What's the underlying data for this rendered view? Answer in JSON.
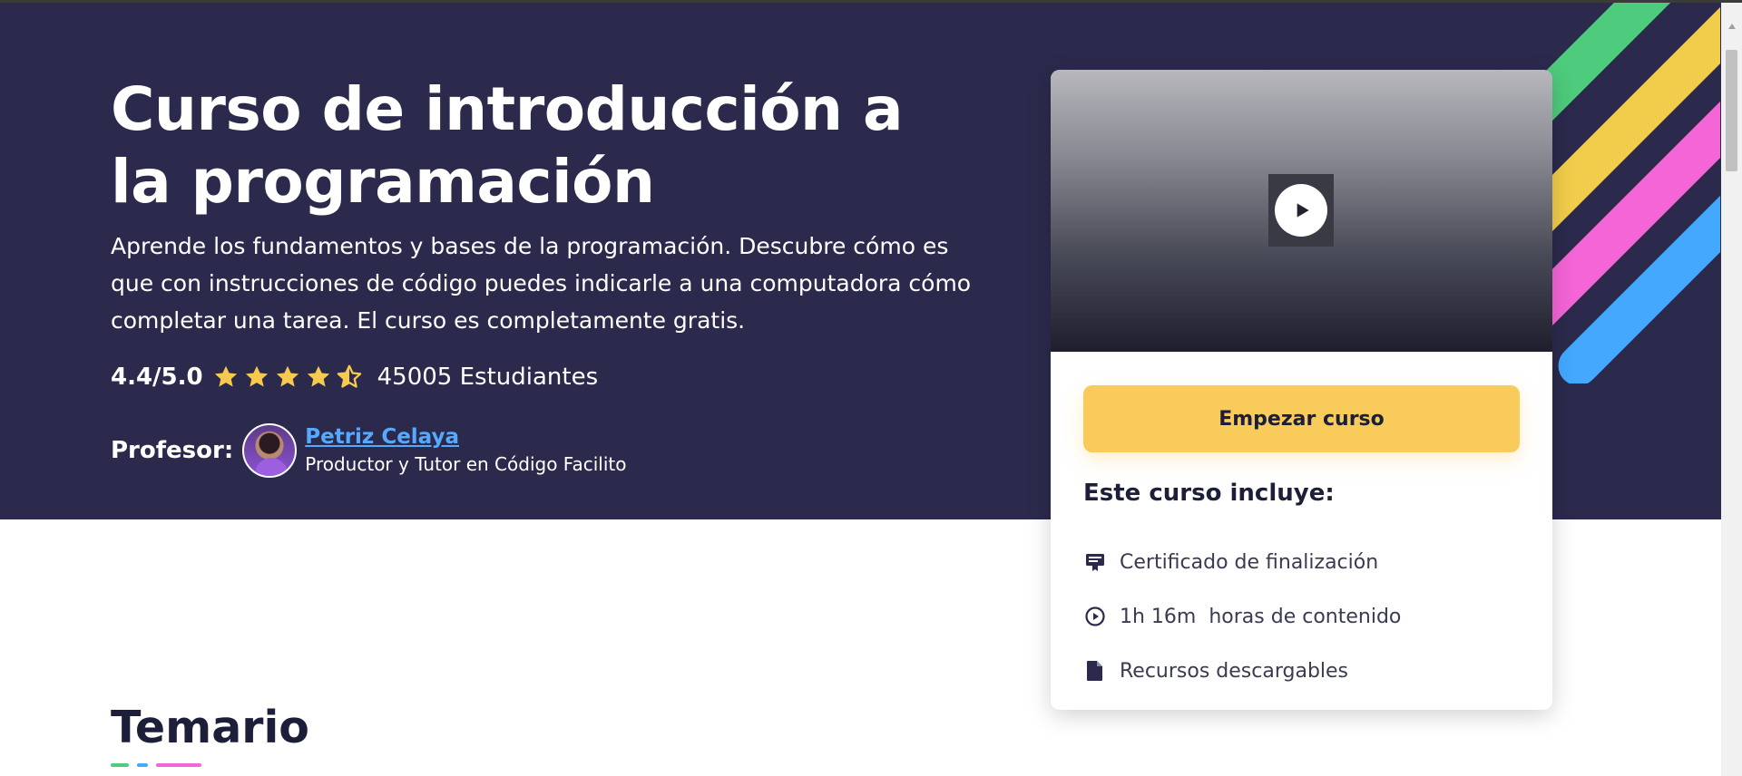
{
  "course": {
    "title": "Curso de introducción a la programación",
    "description": "Aprende los fundamentos y bases de la programación. Descubre cómo es que con instrucciones de código puedes indicarle a una computadora cómo completar una tarea. El curso es completamente gratis.",
    "rating": "4.4/5.0",
    "rating_value": 4.4,
    "rating_max": 5,
    "students": "45005 Estudiantes"
  },
  "teacher": {
    "label": "Profesor:",
    "name": "Petriz Celaya",
    "role": "Productor y Tutor en Código Facilito"
  },
  "card": {
    "video_icon": "play-icon",
    "start_button": "Empezar curso",
    "includes_title": "Este curso incluye:",
    "includes": [
      {
        "icon": "certificate-icon",
        "text": "Certificado de finalización"
      },
      {
        "icon": "clock-play-icon",
        "text": "1h 16m  horas de contenido"
      },
      {
        "icon": "file-icon",
        "text": "Recursos descargables"
      }
    ]
  },
  "syllabus": {
    "title": "Temario"
  },
  "colors": {
    "hero_background": "#2b2a4d",
    "accent_yellow": "#f8cb5a",
    "star": "#f8c94f",
    "link_blue": "#55aaff",
    "stripe_green": "#4ecb7d",
    "stripe_yellow": "#f2cd4b",
    "stripe_pink": "#f465d6",
    "stripe_blue": "#42a9ff"
  }
}
